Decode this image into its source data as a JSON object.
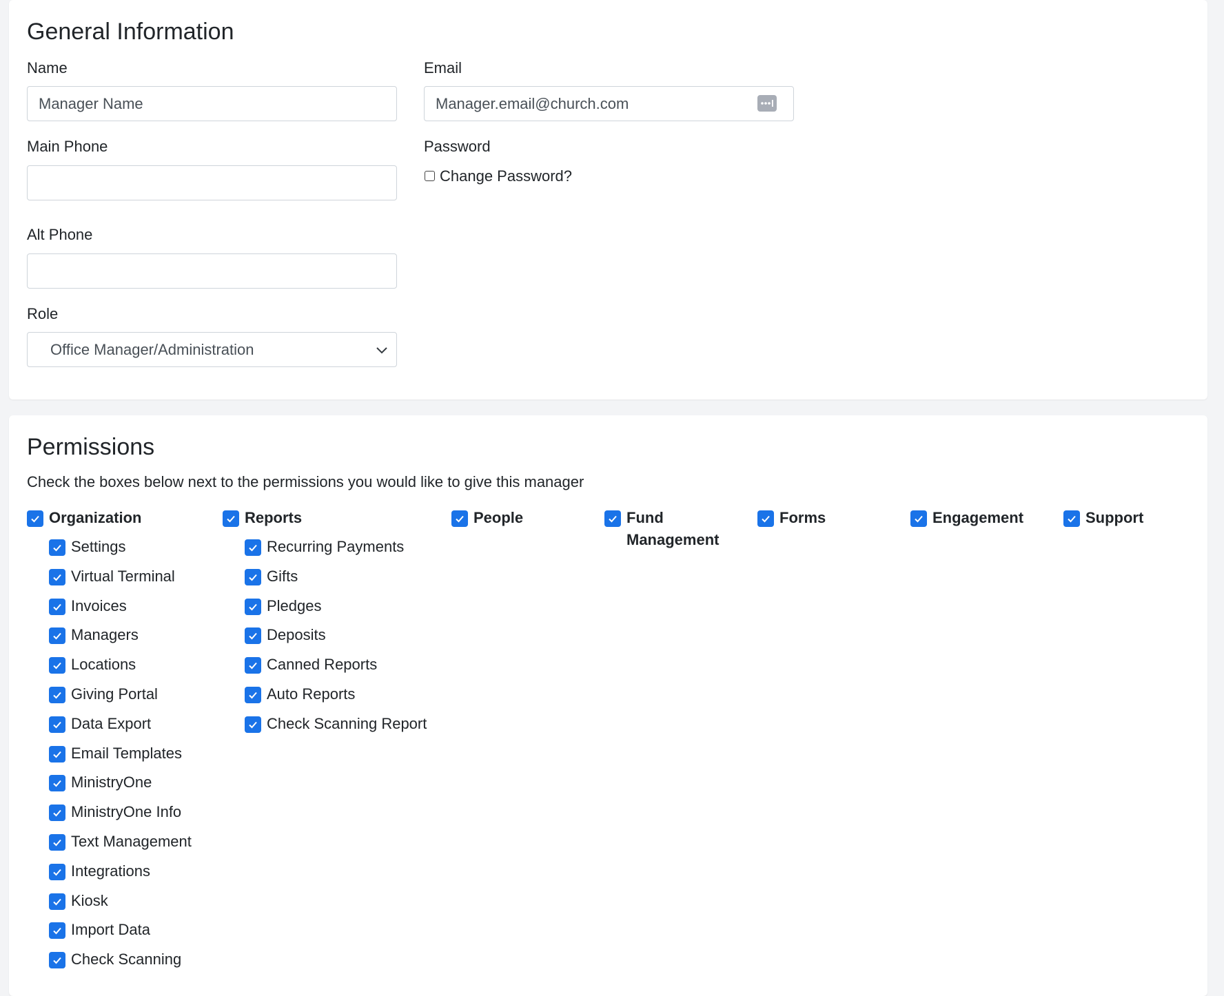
{
  "general": {
    "title": "General Information",
    "name_label": "Name",
    "name_value": "Manager Name",
    "email_label": "Email",
    "email_value": "Manager.email@church.com",
    "main_phone_label": "Main Phone",
    "main_phone_value": "",
    "password_label": "Password",
    "change_password_label": "Change Password?",
    "change_password_checked": false,
    "alt_phone_label": "Alt Phone",
    "alt_phone_value": "",
    "role_label": "Role",
    "role_value": "Office Manager/Administration"
  },
  "permissions": {
    "title": "Permissions",
    "description": "Check the boxes below next to the permissions you would like to give this manager",
    "checkbox_color": "#1a73e8",
    "groups": [
      {
        "label": "Organization",
        "checked": true,
        "items": [
          {
            "label": "Settings",
            "checked": true
          },
          {
            "label": "Virtual Terminal",
            "checked": true
          },
          {
            "label": "Invoices",
            "checked": true
          },
          {
            "label": "Managers",
            "checked": true
          },
          {
            "label": "Locations",
            "checked": true
          },
          {
            "label": "Giving Portal",
            "checked": true
          },
          {
            "label": "Data Export",
            "checked": true
          },
          {
            "label": "Email Templates",
            "checked": true
          },
          {
            "label": "MinistryOne",
            "checked": true
          },
          {
            "label": "MinistryOne Info",
            "checked": true
          },
          {
            "label": "Text Management",
            "checked": true
          },
          {
            "label": "Integrations",
            "checked": true
          },
          {
            "label": "Kiosk",
            "checked": true
          },
          {
            "label": "Import Data",
            "checked": true
          },
          {
            "label": "Check Scanning",
            "checked": true
          }
        ]
      },
      {
        "label": "Reports",
        "checked": true,
        "items": [
          {
            "label": "Recurring Payments",
            "checked": true
          },
          {
            "label": "Gifts",
            "checked": true
          },
          {
            "label": "Pledges",
            "checked": true
          },
          {
            "label": "Deposits",
            "checked": true
          },
          {
            "label": "Canned Reports",
            "checked": true
          },
          {
            "label": "Auto Reports",
            "checked": true
          },
          {
            "label": "Check Scanning Report",
            "checked": true
          }
        ]
      },
      {
        "label": "People",
        "checked": true,
        "items": []
      },
      {
        "label": "Fund Management",
        "checked": true,
        "items": []
      },
      {
        "label": "Forms",
        "checked": true,
        "items": []
      },
      {
        "label": "Engagement",
        "checked": true,
        "items": []
      },
      {
        "label": "Support",
        "checked": true,
        "items": []
      }
    ]
  }
}
